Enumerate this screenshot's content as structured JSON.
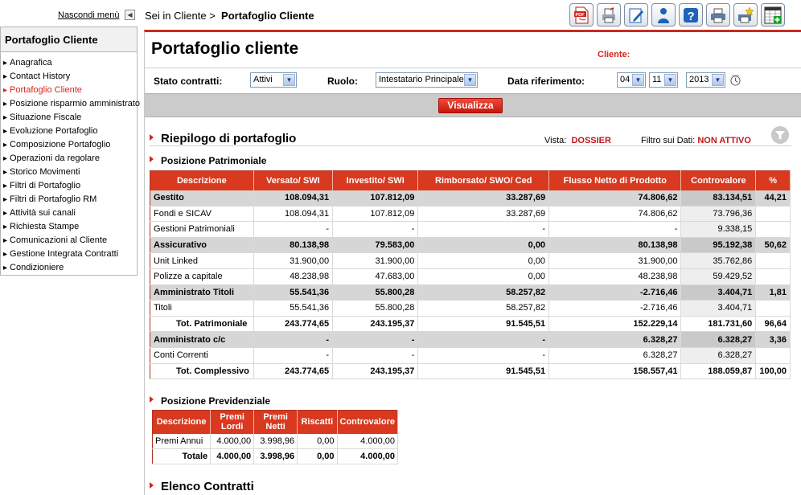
{
  "top": {
    "hide_menu_label": "Nascondi menù",
    "breadcrumb_prefix": "Sei in Cliente >",
    "breadcrumb_current": "Portafoglio Cliente",
    "toolbar_icons": [
      "pdf-icon",
      "printer-icon",
      "edit-icon",
      "user-icon",
      "help-icon",
      "print-icon",
      "favorites-icon",
      "export-excel-icon"
    ]
  },
  "sidebar": {
    "title": "Portafoglio Cliente",
    "items": [
      {
        "label": "Anagrafica",
        "active": false
      },
      {
        "label": "Contact History",
        "active": false
      },
      {
        "label": "Portafoglio Cliente",
        "active": true
      },
      {
        "label": "Posizione risparmio amministrato",
        "active": false
      },
      {
        "label": "Situazione Fiscale",
        "active": false
      },
      {
        "label": "Evoluzione Portafoglio",
        "active": false
      },
      {
        "label": "Composizione Portafoglio",
        "active": false
      },
      {
        "label": "Operazioni da regolare",
        "active": false
      },
      {
        "label": "Storico Movimenti",
        "active": false
      },
      {
        "label": "Filtri di Portafoglio",
        "active": false
      },
      {
        "label": "Filtri di Portafoglio RM",
        "active": false
      },
      {
        "label": "Attività sui canali",
        "active": false
      },
      {
        "label": "Richiesta Stampe",
        "active": false
      },
      {
        "label": "Comunicazioni al Cliente",
        "active": false
      },
      {
        "label": "Gestione Integrata Contratti",
        "active": false
      },
      {
        "label": "Condizioniere",
        "active": false
      }
    ]
  },
  "main": {
    "title": "Portafoglio cliente",
    "client_label": "Cliente:",
    "filters": {
      "stato_label": "Stato contratti:",
      "stato_value": "Attivi",
      "ruolo_label": "Ruolo:",
      "ruolo_value": "Intestatario Principale",
      "data_label": "Data riferimento:",
      "day": "04",
      "month": "11",
      "year": "2013"
    },
    "visualizza_label": "Visualizza",
    "riepilogo_title": "Riepilogo di portafoglio",
    "vista_label": "Vista:",
    "vista_value": "DOSSIER",
    "filtro_label": "Filtro sui Dati:",
    "filtro_value": "NON ATTIVO",
    "patrimoniale_title": "Posizione Patrimoniale",
    "patrimoniale": {
      "headers": [
        "Descrizione",
        "Versato/ SWI",
        "Investito/ SWI",
        "Rimborsato/ SWO/ Ced",
        "Flusso Netto di Prodotto",
        "Controvalore",
        "%"
      ],
      "rows": [
        {
          "type": "grp",
          "cells": [
            "Gestito",
            "108.094,31",
            "107.812,09",
            "33.287,69",
            "74.806,62",
            "83.134,51",
            "44,21"
          ]
        },
        {
          "type": "item",
          "cells": [
            "Fondi e SICAV",
            "108.094,31",
            "107.812,09",
            "33.287,69",
            "74.806,62",
            "73.796,36",
            ""
          ]
        },
        {
          "type": "item",
          "cells": [
            "Gestioni Patrimoniali",
            "-",
            "-",
            "-",
            "-",
            "9.338,15",
            ""
          ]
        },
        {
          "type": "grp",
          "cells": [
            "Assicurativo",
            "80.138,98",
            "79.583,00",
            "0,00",
            "80.138,98",
            "95.192,38",
            "50,62"
          ]
        },
        {
          "type": "item",
          "cells": [
            "Unit Linked",
            "31.900,00",
            "31.900,00",
            "0,00",
            "31.900,00",
            "35.762,86",
            ""
          ]
        },
        {
          "type": "item",
          "cells": [
            "Polizze a capitale",
            "48.238,98",
            "47.683,00",
            "0,00",
            "48.238,98",
            "59.429,52",
            ""
          ]
        },
        {
          "type": "grp",
          "cells": [
            "Amministrato Titoli",
            "55.541,36",
            "55.800,28",
            "58.257,82",
            "-2.716,46",
            "3.404,71",
            "1,81"
          ]
        },
        {
          "type": "item",
          "cells": [
            "Titoli",
            "55.541,36",
            "55.800,28",
            "58.257,82",
            "-2.716,46",
            "3.404,71",
            ""
          ]
        },
        {
          "type": "tot",
          "cells": [
            "Tot. Patrimoniale",
            "243.774,65",
            "243.195,37",
            "91.545,51",
            "152.229,14",
            "181.731,60",
            "96,64"
          ]
        },
        {
          "type": "grp",
          "cells": [
            "Amministrato c/c",
            "-",
            "-",
            "-",
            "6.328,27",
            "6.328,27",
            "3,36"
          ]
        },
        {
          "type": "item",
          "cells": [
            "Conti Correnti",
            "-",
            "-",
            "-",
            "6.328,27",
            "6.328,27",
            ""
          ]
        },
        {
          "type": "tot",
          "cells": [
            "Tot. Complessivo",
            "243.774,65",
            "243.195,37",
            "91.545,51",
            "158.557,41",
            "188.059,87",
            "100,00"
          ]
        }
      ]
    },
    "previdenziale_title": "Posizione Previdenziale",
    "previdenziale": {
      "headers": [
        "Descrizione",
        "Premi Lordi",
        "Premi Netti",
        "Riscatti",
        "Controvalore"
      ],
      "rows": [
        {
          "type": "item",
          "cells": [
            "Premi Annui",
            "4.000,00",
            "3.998,96",
            "0,00",
            "4.000,00"
          ]
        },
        {
          "type": "tot",
          "cells": [
            "Totale",
            "4.000,00",
            "3.998,96",
            "0,00",
            "4.000,00"
          ]
        }
      ]
    },
    "contratti_title": "Elenco Contratti"
  }
}
